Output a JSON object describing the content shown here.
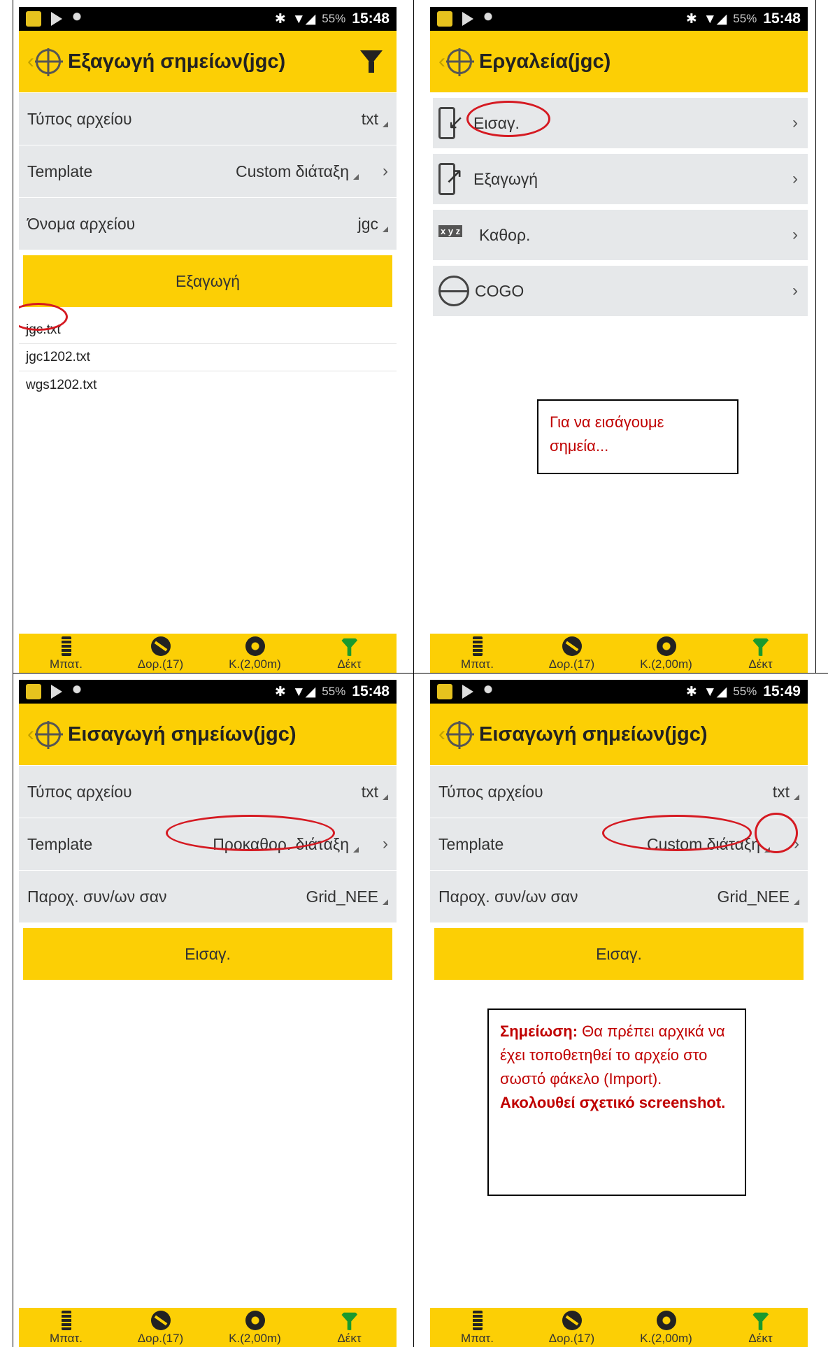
{
  "panels": [
    {
      "status": {
        "percent": "55%",
        "time": "15:48"
      },
      "title": "Εξαγωγή σημείων(jgc)",
      "rows": [
        {
          "label": "Τύπος αρχείου",
          "value": "txt"
        },
        {
          "label": "Template",
          "value": "Custom διάταξη"
        },
        {
          "label": "Όνομα αρχείου",
          "value": "jgc"
        }
      ],
      "button": "Εξαγωγή",
      "files": [
        "jgc.txt",
        "jgc1202.txt",
        "wgs1202.txt"
      ]
    },
    {
      "status": {
        "percent": "55%",
        "time": "15:48"
      },
      "title": "Εργαλεία(jgc)",
      "tools": [
        "Εισαγ.",
        "Εξαγωγή",
        "Καθορ.",
        "COGO"
      ],
      "xyz": "x y z",
      "note": "Για να εισάγουμε σημεία..."
    },
    {
      "status": {
        "percent": "55%",
        "time": "15:48"
      },
      "title": "Εισαγωγή σημείων(jgc)",
      "rows": [
        {
          "label": "Τύπος αρχείου",
          "value": "txt"
        },
        {
          "label": "Template",
          "value": "Προκαθορ. διάταξη"
        },
        {
          "label": "Παροχ. συν/ων σαν",
          "value": "Grid_NEE"
        }
      ],
      "button": "Εισαγ."
    },
    {
      "status": {
        "percent": "55%",
        "time": "15:49"
      },
      "title": "Εισαγωγή σημείων(jgc)",
      "rows": [
        {
          "label": "Τύπος αρχείου",
          "value": "txt"
        },
        {
          "label": "Template",
          "value": "Custom διάταξη"
        },
        {
          "label": "Παροχ. συν/ων σαν",
          "value": "Grid_NEE"
        }
      ],
      "button": "Εισαγ.",
      "note": {
        "bold1": "Σημείωση:",
        "text": " Θα πρέπει αρχικά να έχει τοποθετηθεί το αρχείο στο σωστό φάκελο (Import).",
        "bold2": " Ακολουθεί σχετικό screenshot."
      }
    }
  ],
  "bottombar": [
    "Μπατ.",
    "Δορ.(17)",
    "Κ.(2,00m)",
    "Δέκτ"
  ]
}
